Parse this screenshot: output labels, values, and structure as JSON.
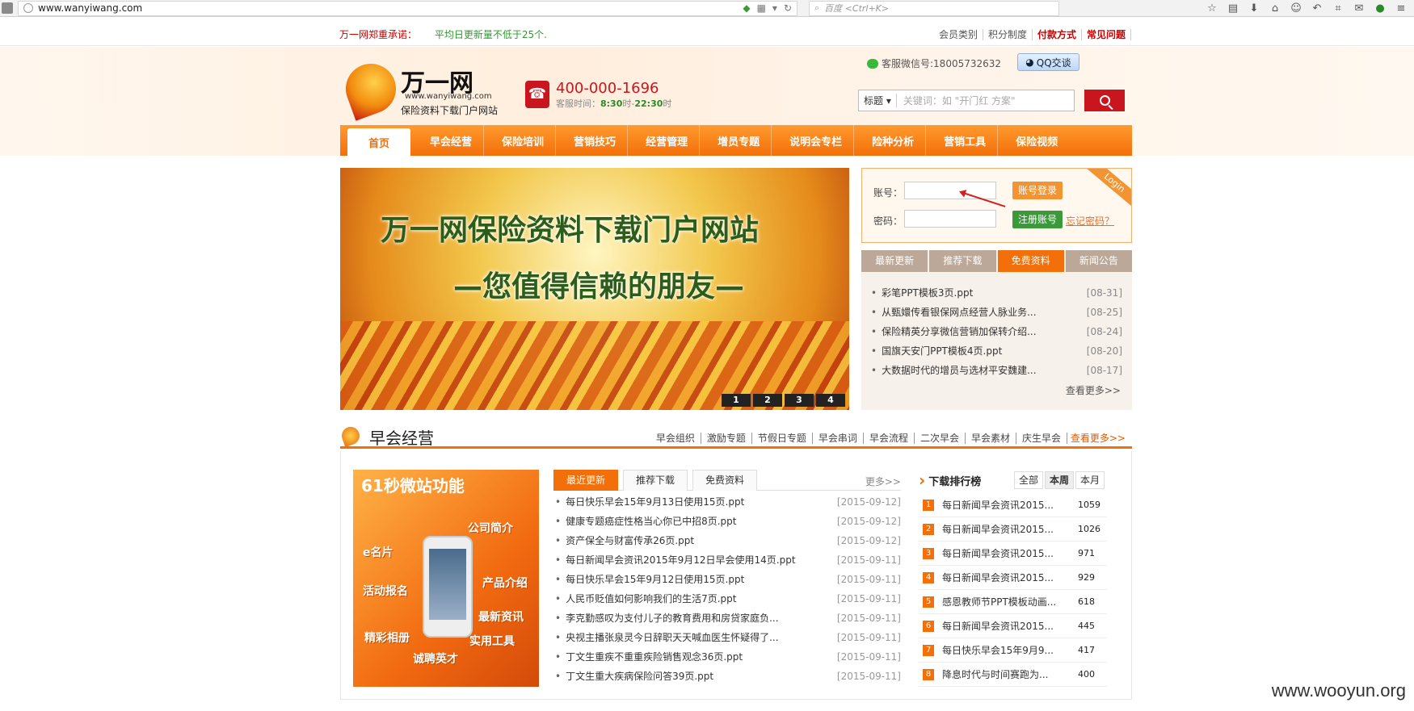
{
  "browser": {
    "url": "www.wanyiwang.com",
    "search_placeholder": "百度 <Ctrl+K>"
  },
  "topbar": {
    "promise_label": "万一网郑重承诺：",
    "promise_text": "平均日更新量不低于25个.",
    "links": [
      "会员类别",
      "积分制度",
      "付款方式",
      "常见问题"
    ]
  },
  "header": {
    "logo_name": "万一网",
    "logo_domain": "www.wanyiwang.com",
    "logo_sub": "保险资料下载门户网站",
    "phone": "400-000-1696",
    "hours_prefix": "客服时间：",
    "hours_start": "8:30",
    "hours_mid": "时-",
    "hours_end": "22:30",
    "hours_suffix": "时",
    "wechat": "客服微信号:18005732632",
    "qq": "QQ交谈",
    "search_select": "标题",
    "search_placeholder": "关键词：如 \"开门红 方案\""
  },
  "nav": [
    "首页",
    "早会经营",
    "保险培训",
    "营销技巧",
    "经营管理",
    "增员专题",
    "说明会专栏",
    "险种分析",
    "营销工具",
    "保险视频"
  ],
  "banner": {
    "line1": "万一网保险资料下载门户网站",
    "line2": "—您值得信赖的朋友—",
    "pages": [
      "1",
      "2",
      "3",
      "4"
    ]
  },
  "login": {
    "ribbon": "Login",
    "account_label": "账号：",
    "password_label": "密码：",
    "login_btn": "账号登录",
    "register_btn": "注册账号",
    "forgot": "忘记密码？"
  },
  "side_tabs": {
    "tabs": [
      "最新更新",
      "推荐下载",
      "免费资料",
      "新闻公告"
    ],
    "items": [
      {
        "title": "彩笔PPT模板3页.ppt",
        "date": "[08-31]"
      },
      {
        "title": "从甄嬛传看银保网点经营人脉业务...",
        "date": "[08-25]"
      },
      {
        "title": "保险精英分享微信营销加保转介绍...",
        "date": "[08-24]"
      },
      {
        "title": "国旗天安门PPT模板4页.ppt",
        "date": "[08-20]"
      },
      {
        "title": "大数据时代的增员与选材平安魏建...",
        "date": "[08-17]"
      }
    ],
    "more": "查看更多>>"
  },
  "section": {
    "title": "早会经营",
    "links": [
      "早会组织",
      "激励专题",
      "节假日专题",
      "早会串词",
      "早会流程",
      "二次早会",
      "早会素材",
      "庆生早会"
    ],
    "more": "查看更多>>"
  },
  "promo": {
    "title": "61秒微站功能",
    "labels": [
      "公司简介",
      "e名片",
      "产品介绍",
      "活动报名",
      "最新资讯",
      "精彩相册",
      "实用工具",
      "诚聘英才"
    ]
  },
  "latest": {
    "tabs": [
      "最近更新",
      "推荐下载",
      "免费资料"
    ],
    "more": "更多>>",
    "items": [
      {
        "title": "每日快乐早会15年9月13日使用15页.ppt",
        "date": "[2015-09-12]"
      },
      {
        "title": "健康专题癌症性格当心你已中招8页.ppt",
        "date": "[2015-09-12]"
      },
      {
        "title": "资产保全与财富传承26页.ppt",
        "date": "[2015-09-12]"
      },
      {
        "title": "每日新闻早会资讯2015年9月12日早会使用14页.ppt",
        "date": "[2015-09-11]"
      },
      {
        "title": "每日快乐早会15年9月12日使用15页.ppt",
        "date": "[2015-09-11]"
      },
      {
        "title": "人民币贬值如何影响我们的生活7页.ppt",
        "date": "[2015-09-11]"
      },
      {
        "title": "李克勤感叹为支付儿子的教育费用和房贷家庭负...",
        "date": "[2015-09-11]"
      },
      {
        "title": "央视主播张泉灵今日辞职天天喊血医生怀疑得了...",
        "date": "[2015-09-11]"
      },
      {
        "title": "丁文生重疾不重重疾险销售观念36页.ppt",
        "date": "[2015-09-11]"
      },
      {
        "title": "丁文生重大疾病保险问答39页.ppt",
        "date": "[2015-09-11]"
      }
    ]
  },
  "ranking": {
    "title": "下载排行榜",
    "tabs": [
      "全部",
      "本周",
      "本月"
    ],
    "items": [
      {
        "no": "1",
        "title": "每日新闻早会资讯2015...",
        "count": "1059"
      },
      {
        "no": "2",
        "title": "每日新闻早会资讯2015...",
        "count": "1026"
      },
      {
        "no": "3",
        "title": "每日新闻早会资讯2015...",
        "count": "971"
      },
      {
        "no": "4",
        "title": "每日新闻早会资讯2015...",
        "count": "929"
      },
      {
        "no": "5",
        "title": "感恩教师节PPT模板动画...",
        "count": "618"
      },
      {
        "no": "6",
        "title": "每日新闻早会资讯2015...",
        "count": "445"
      },
      {
        "no": "7",
        "title": "每日快乐早会15年9月9...",
        "count": "417"
      },
      {
        "no": "8",
        "title": "降息时代与时间赛跑为...",
        "count": "400"
      }
    ]
  },
  "watermark": "www.wooyun.org"
}
